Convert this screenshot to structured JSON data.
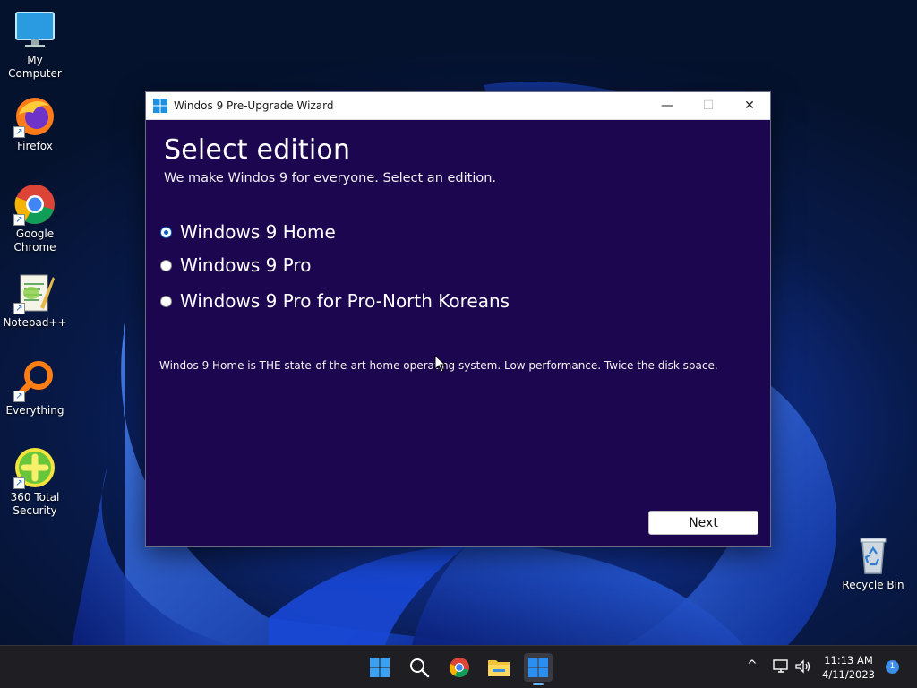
{
  "desktop": {
    "icons": [
      {
        "label": "My Computer",
        "icon": "monitor-icon"
      },
      {
        "label": "Firefox",
        "icon": "firefox-icon"
      },
      {
        "label": "Google Chrome",
        "icon": "chrome-icon"
      },
      {
        "label": "Notepad++",
        "icon": "notepadpp-icon"
      },
      {
        "label": "Everything",
        "icon": "search-magnifier-icon"
      },
      {
        "label": "360 Total Security",
        "icon": "security-plus-icon"
      },
      {
        "label": "Recycle Bin",
        "icon": "recycle-bin-icon"
      }
    ]
  },
  "window": {
    "title": "Windos 9 Pre-Upgrade Wizard",
    "controls": {
      "minimize": "—",
      "maximize": "☐",
      "close": "✕"
    },
    "heading": "Select edition",
    "subheading": "We make Windos 9 for everyone. Select an edition.",
    "options": [
      {
        "label": "Windows 9 Home",
        "checked": true
      },
      {
        "label": "Windows 9 Pro",
        "checked": false
      },
      {
        "label": "Windows 9 Pro for Pro-North Koreans",
        "checked": false
      }
    ],
    "description": "Windos 9 Home is THE state-of-the-art home operating system. Low performance. Twice the disk space.",
    "next_label": "Next"
  },
  "taskbar": {
    "items": [
      "start-icon",
      "search-icon",
      "chrome-icon",
      "file-explorer-icon",
      "wizard-app-icon"
    ],
    "tray": {
      "chevron": "^",
      "time": "11:13 AM",
      "date": "4/11/2023",
      "notifications": "1"
    }
  },
  "colors": {
    "window_bg": "#1d0650",
    "radio_accent": "#0a64c8",
    "taskbar_bg": "#1f1f23"
  }
}
